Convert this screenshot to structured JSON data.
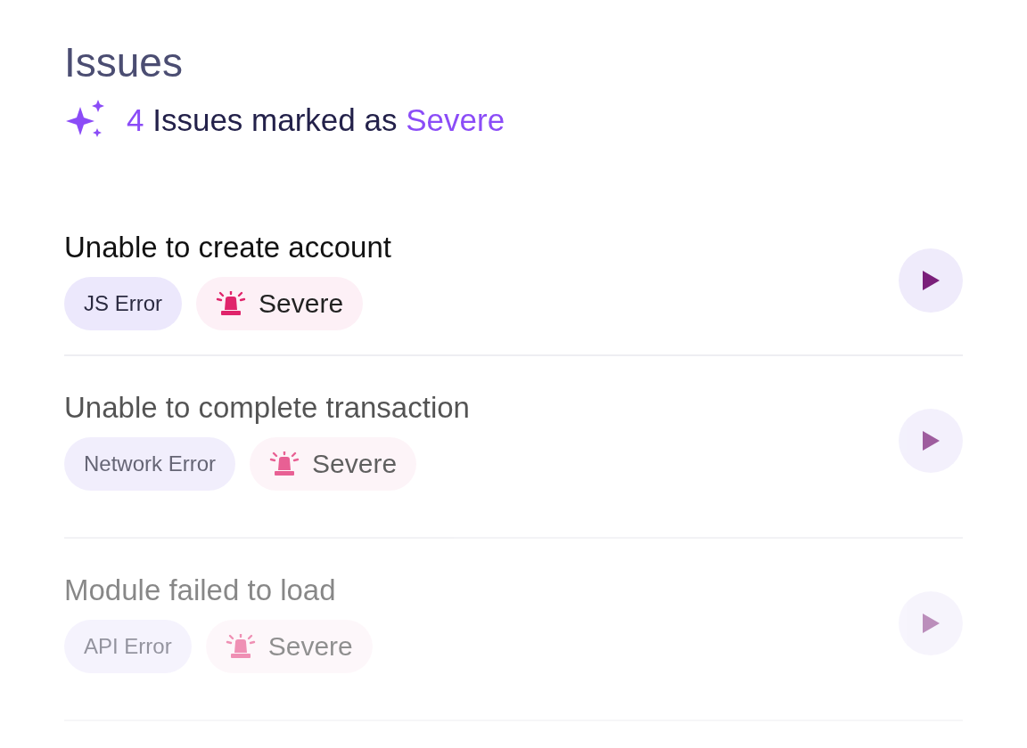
{
  "title": "Issues",
  "summary": {
    "count": "4",
    "text": "Issues marked as",
    "highlight": "Severe"
  },
  "issues": [
    {
      "title": "Unable to create account",
      "type": "JS Error",
      "severity": "Severe"
    },
    {
      "title": "Unable to complete transaction",
      "type": "Network Error",
      "severity": "Severe"
    },
    {
      "title": "Module failed to load",
      "type": "API Error",
      "severity": "Severe"
    }
  ]
}
